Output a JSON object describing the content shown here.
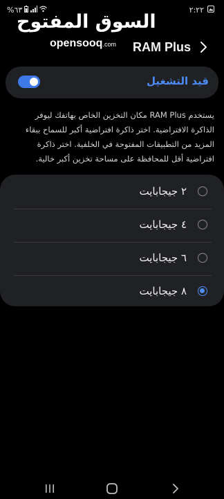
{
  "status_bar": {
    "time": "٢:٢٢",
    "battery": "%٦٣",
    "left_icons": [
      "battery-icon",
      "signal-icon",
      "wifi-icon"
    ],
    "right_icons": [
      "gallery-notification-icon"
    ]
  },
  "watermark": {
    "arabic": "السوق المفتوح",
    "latin": "opensooq",
    "suffix": ".com"
  },
  "app_bar": {
    "title": "RAM Plus",
    "back_icon": "chevron-right-icon"
  },
  "toggle": {
    "label": "قيد التشغيل",
    "on": true,
    "accent_color": "#4d8cf5"
  },
  "description": "يستخدم RAM Plus مكان التخزين الخاص بهاتفك ليوفر الذاكرة الافتراضية. اختر ذاكرة افتراضية أكبر للسماح ببقاء المزيد من التطبيقات المفتوحة في الخلفية. اختر ذاكرة افتراضية أقل للمحافظة على مساحة تخزين أكبر خالية.",
  "options": [
    {
      "label": "٢ جيجابايت",
      "selected": false
    },
    {
      "label": "٤ جيجابايت",
      "selected": false
    },
    {
      "label": "٦ جيجابايت",
      "selected": false
    },
    {
      "label": "٨ جيجابايت",
      "selected": true
    }
  ],
  "nav_bar": {
    "items": [
      "recent-apps-icon",
      "home-icon",
      "back-icon"
    ]
  }
}
